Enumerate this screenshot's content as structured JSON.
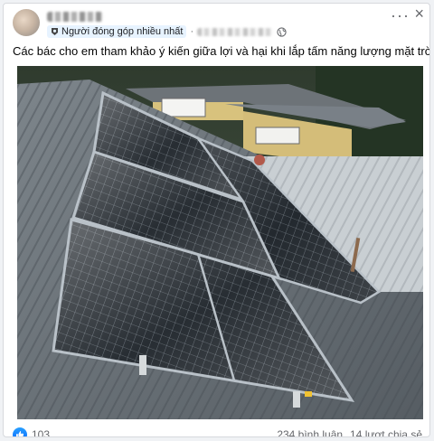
{
  "post": {
    "badge_label": "Người đóng góp nhiều nhất",
    "text": "Các bác cho em tham khảo ý kiến giữa lợi và hại khi lắp tấm năng lượng mặt trời ạ?",
    "more_icon": "more-horizontal-icon",
    "close_icon": "close-icon",
    "privacy_icon": "globe-icon"
  },
  "footer": {
    "reaction_icon": "like-icon",
    "reaction_count": "103",
    "comments": "234 bình luận",
    "shares": "14 lượt chia sẻ"
  },
  "colors": {
    "accent": "#0866ff",
    "secondary_text": "#65676b",
    "badge_bg": "#e7f3ff"
  }
}
